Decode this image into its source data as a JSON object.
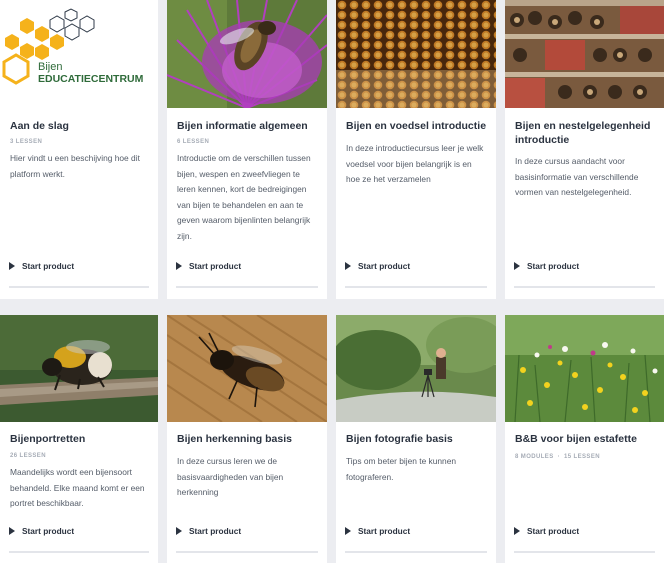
{
  "start_label": "Start product",
  "logo": {
    "line1": "Bijen",
    "line2": "EDUCATIECENTRUM"
  },
  "cards": [
    {
      "title": "Aan de slag",
      "meta": "3 LESSEN",
      "meta2": "",
      "desc": "Hier vindt u een beschijving hoe dit platform werkt."
    },
    {
      "title": "Bijen informatie algemeen",
      "meta": "6 LESSEN",
      "meta2": "",
      "desc": "Introductie om de verschillen tussen bijen, wespen en zweefvliegen te leren kennen, kort de bedreigingen van bijen te behandelen en aan te geven waarom bijenlinten belangrijk zijn."
    },
    {
      "title": "Bijen en voedsel introductie",
      "meta": "",
      "meta2": "",
      "desc": "In deze introductiecursus leer je welk voedsel voor bijen belangrijk is en hoe ze het verzamelen"
    },
    {
      "title": "Bijen en nestelgelegenheid introductie",
      "meta": "",
      "meta2": "",
      "desc": "In deze cursus aandacht voor basisinformatie van verschillende vormen van nestelgelegenheid."
    },
    {
      "title": "Bijenportretten",
      "meta": "26 LESSEN",
      "meta2": "",
      "desc": "Maandelijks wordt een bijensoort behandeld. Elke maand komt er een portret beschikbaar."
    },
    {
      "title": "Bijen herkenning basis",
      "meta": "",
      "meta2": "",
      "desc": "In deze cursus leren we de basisvaardigheden van bijen herkenning"
    },
    {
      "title": "Bijen fotografie basis",
      "meta": "",
      "meta2": "",
      "desc": "Tips om beter bijen te kunnen fotograferen."
    },
    {
      "title": "B&B voor bijen estafette",
      "meta": "8 MODULES",
      "meta2": "15 LESSEN",
      "desc": ""
    }
  ]
}
